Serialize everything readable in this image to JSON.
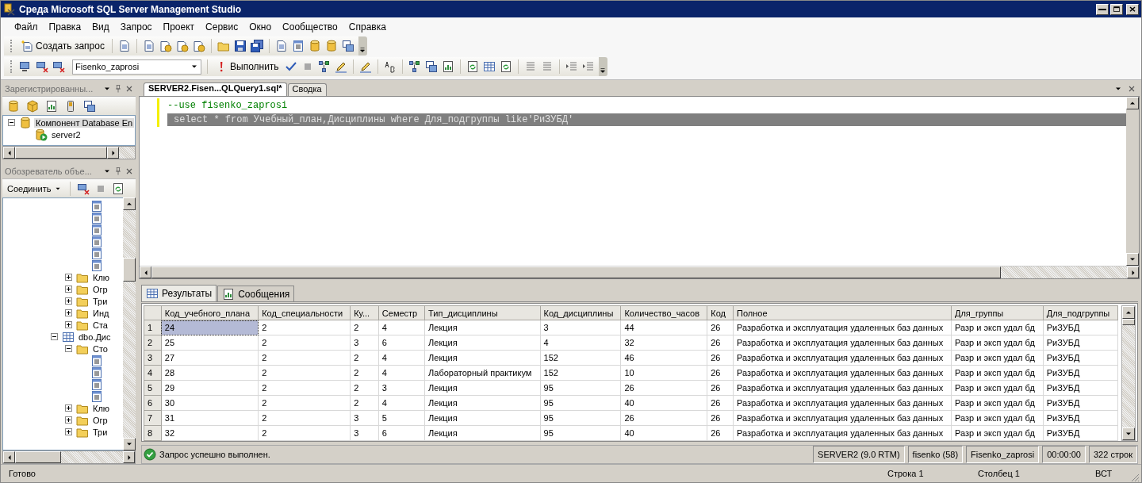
{
  "window": {
    "title": "Среда Microsoft SQL Server Management Studio"
  },
  "menu": [
    "Файл",
    "Правка",
    "Вид",
    "Запрос",
    "Проект",
    "Сервис",
    "Окно",
    "Сообщество",
    "Справка"
  ],
  "toolbar_1": {
    "new_query": "Создать запрос"
  },
  "toolbar_2": {
    "database": "Fisenko_zaprosi",
    "execute": "Выполнить"
  },
  "registered_servers": {
    "title": "Зарегистрированны...",
    "tree": [
      {
        "kind": "group",
        "label": "Компонент Database En",
        "expanded": true,
        "selected": true,
        "children": [
          {
            "kind": "server",
            "label": "server2",
            "selected": false
          }
        ]
      }
    ]
  },
  "object_explorer": {
    "title": "Обозреватель объе...",
    "connect": "Соединить",
    "tree": [
      {
        "kind": "continued",
        "children": [
          {
            "kind": "continued",
            "children": [
              {
                "kind": "column"
              },
              {
                "kind": "column"
              },
              {
                "kind": "column"
              },
              {
                "kind": "column"
              },
              {
                "kind": "column"
              },
              {
                "kind": "column"
              }
            ]
          },
          {
            "kind": "folder",
            "label": "Клю",
            "expanded": false
          },
          {
            "kind": "folder",
            "label": "Огр",
            "expanded": false
          },
          {
            "kind": "folder",
            "label": "Три",
            "expanded": false
          },
          {
            "kind": "folder",
            "label": "Инд",
            "expanded": false
          },
          {
            "kind": "folder",
            "label": "Ста",
            "expanded": false
          }
        ]
      },
      {
        "kind": "table",
        "label": "dbo.Дис",
        "expanded": true,
        "children": [
          {
            "kind": "folder",
            "label": "Сто",
            "expanded": true,
            "children": [
              {
                "kind": "column"
              },
              {
                "kind": "column"
              },
              {
                "kind": "column"
              },
              {
                "kind": "column"
              }
            ]
          },
          {
            "kind": "folder",
            "label": "Клю",
            "expanded": false
          },
          {
            "kind": "folder",
            "label": "Огр",
            "expanded": false
          },
          {
            "kind": "folder",
            "label": "Три",
            "expanded": false
          }
        ]
      }
    ]
  },
  "editor": {
    "tabs": [
      {
        "label": "SERVER2.Fisen...QLQuery1.sql*",
        "selected": true
      },
      {
        "label": "Сводка",
        "selected": false
      }
    ],
    "lines": [
      {
        "kind": "comment",
        "text": "--use fisenko_zaprosi",
        "selected": false
      },
      {
        "kind": "code",
        "text": "select * from Учебный_план,Дисциплины where Для_подгруппы like'РиЗУБД'",
        "selected": true
      }
    ]
  },
  "results": {
    "tabs": [
      {
        "label": "Результаты",
        "kind": "grid",
        "selected": true
      },
      {
        "label": "Сообщения",
        "kind": "messages",
        "selected": false
      }
    ],
    "columns": [
      "Код_учебного_плана",
      "Код_специальности",
      "Ку...",
      "Семестр",
      "Тип_дисциплины",
      "Код_дисциплины",
      "Количество_часов",
      "Код",
      "Полное",
      "Для_группы",
      "Для_подгруппы"
    ],
    "rows": [
      {
        "number": "1",
        "selected": true,
        "cells": [
          "24",
          "2",
          "2",
          "4",
          "Лекция",
          "3",
          "44",
          "26",
          "Разработка и эксплуатация удаленных баз данных",
          "Разр и эксп удал бд",
          "РиЗУБД"
        ]
      },
      {
        "number": "2",
        "selected": false,
        "cells": [
          "25",
          "2",
          "3",
          "6",
          "Лекция",
          "4",
          "32",
          "26",
          "Разработка и эксплуатация удаленных баз данных",
          "Разр и эксп удал бд",
          "РиЗУБД"
        ]
      },
      {
        "number": "3",
        "selected": false,
        "cells": [
          "27",
          "2",
          "2",
          "4",
          "Лекция",
          "152",
          "46",
          "26",
          "Разработка и эксплуатация удаленных баз данных",
          "Разр и эксп удал бд",
          "РиЗУБД"
        ]
      },
      {
        "number": "4",
        "selected": false,
        "cells": [
          "28",
          "2",
          "2",
          "4",
          "Лабораторный практикум",
          "152",
          "10",
          "26",
          "Разработка и эксплуатация удаленных баз данных",
          "Разр и эксп удал бд",
          "РиЗУБД"
        ]
      },
      {
        "number": "5",
        "selected": false,
        "cells": [
          "29",
          "2",
          "2",
          "3",
          "Лекция",
          "95",
          "26",
          "26",
          "Разработка и эксплуатация удаленных баз данных",
          "Разр и эксп удал бд",
          "РиЗУБД"
        ]
      },
      {
        "number": "6",
        "selected": false,
        "cells": [
          "30",
          "2",
          "2",
          "4",
          "Лекция",
          "95",
          "40",
          "26",
          "Разработка и эксплуатация удаленных баз данных",
          "Разр и эксп удал бд",
          "РиЗУБД"
        ]
      },
      {
        "number": "7",
        "selected": false,
        "cells": [
          "31",
          "2",
          "3",
          "5",
          "Лекция",
          "95",
          "26",
          "26",
          "Разработка и эксплуатация удаленных баз данных",
          "Разр и эксп удал бд",
          "РиЗУБД"
        ]
      },
      {
        "number": "8",
        "selected": false,
        "cells": [
          "32",
          "2",
          "3",
          "6",
          "Лекция",
          "95",
          "40",
          "26",
          "Разработка и эксплуатация удаленных баз данных",
          "Разр и эксп удал бд",
          "РиЗУБД"
        ]
      }
    ]
  },
  "query_status": {
    "message": "Запрос успешно выполнен.",
    "fields": [
      "SERVER2 (9.0 RTM)",
      "fisenko (58)",
      "Fisenko_zaprosi",
      "00:00:00",
      "322 строк"
    ]
  },
  "status_bar": {
    "left": "Готово",
    "line": "Строка 1",
    "column": "Столбец 1",
    "mode": "ВСТ"
  }
}
